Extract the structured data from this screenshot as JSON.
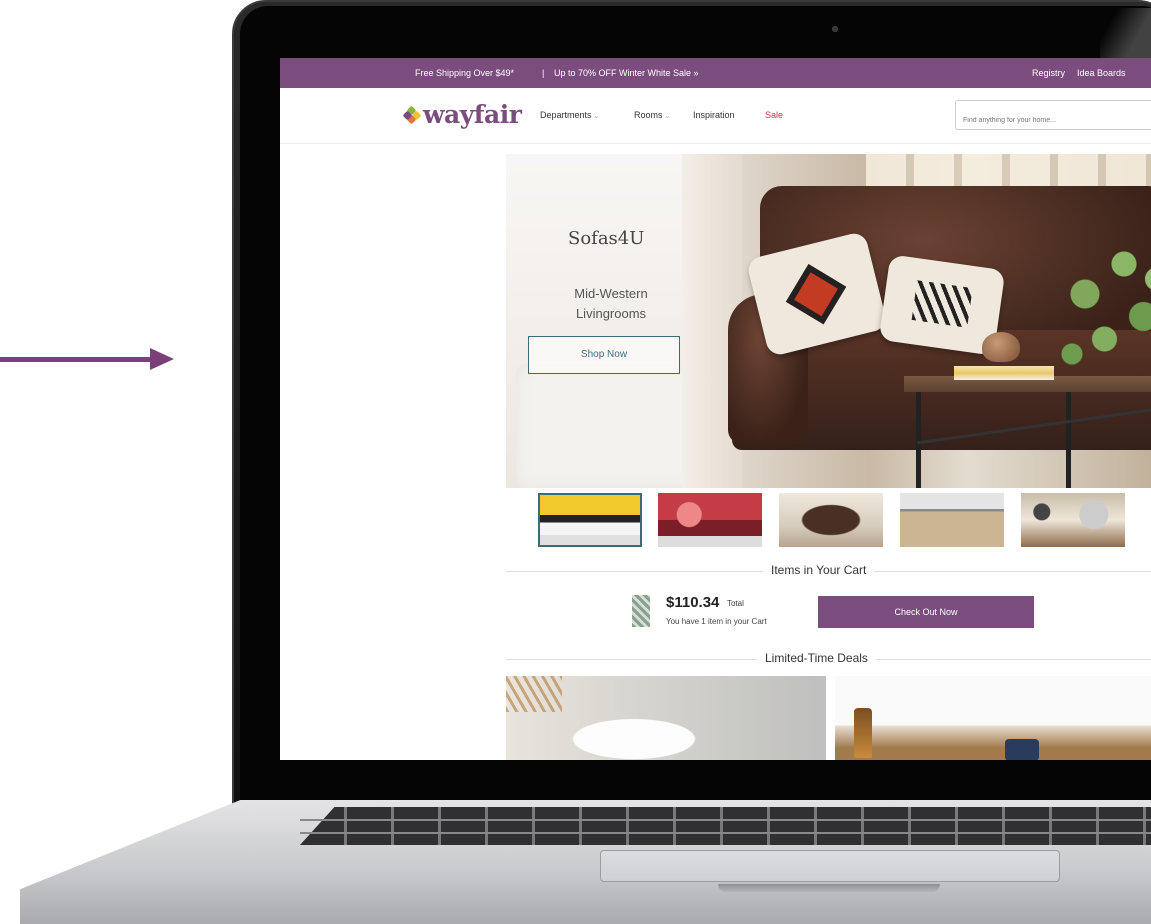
{
  "promo_bar": {
    "shipping_text": "Free Shipping Over $49*",
    "separator": "|",
    "sale_link": "Up to 70% OFF Winter White Sale »",
    "registry": "Registry",
    "idea_boards": "Idea Boards"
  },
  "header": {
    "logo_text": "wayfair",
    "nav": [
      "Departments",
      "Rooms",
      "Inspiration",
      "Sale"
    ],
    "search_placeholder": "Find anything for your home..."
  },
  "hero": {
    "brand": "Sofas4U",
    "subtitle": "Mid-Western\nLivingrooms",
    "cta": "Shop Now"
  },
  "thumbnails": {
    "count": 5,
    "active_index": 0
  },
  "cart": {
    "section_title": "Items in Your Cart",
    "total_amount": "$110.34",
    "total_label": "Total",
    "item_count_text": "You have 1 item in your Cart",
    "checkout_label": "Check Out Now"
  },
  "deals": {
    "section_title": "Limited-Time Deals"
  },
  "colors": {
    "brand_purple": "#7b4c7e",
    "sale_red": "#c6334a",
    "button_teal": "#3f6a7a"
  }
}
